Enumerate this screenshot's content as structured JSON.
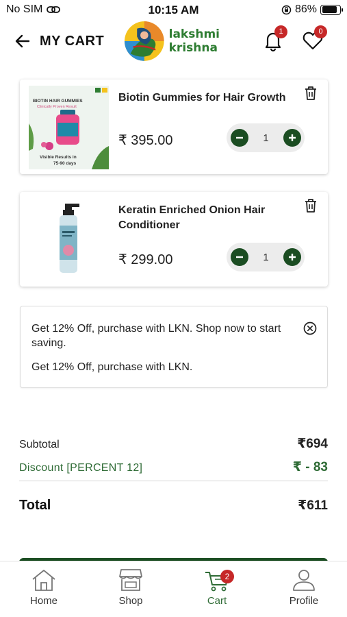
{
  "status_bar": {
    "carrier": "No SIM",
    "time": "10:15 AM",
    "battery_text": "86%",
    "battery_level": 0.86
  },
  "header": {
    "title": "MY CART",
    "logo_line1": "lakshmi",
    "logo_line2": "krishna",
    "notification_count": "1",
    "wishlist_count": "0"
  },
  "cart": {
    "items": [
      {
        "name": "Biotin Gummies for Hair Growth",
        "price": "₹ 395.00",
        "quantity": "1",
        "image_text": {
          "line1": "BIOTIN HAIR GUMMIES",
          "line2": "Clinically Proven Result",
          "line3": "Visible Results in",
          "line4": "75-90 days"
        }
      },
      {
        "name": "Keratin Enriched Onion Hair Conditioner",
        "price": "₹ 299.00",
        "quantity": "1"
      }
    ]
  },
  "offer": {
    "line1": "Get 12% Off, purchase with LKN. Shop now to start saving.",
    "line2": "Get 12% Off, purchase with LKN."
  },
  "summary": {
    "subtotal_label": "Subtotal",
    "subtotal_value": "₹694",
    "discount_label": "Discount [PERCENT 12]",
    "discount_value": "₹ - 83",
    "total_label": "Total",
    "total_value": "₹611"
  },
  "bottom_nav": {
    "items": [
      {
        "label": "Home",
        "icon": "home-icon"
      },
      {
        "label": "Shop",
        "icon": "shop-icon"
      },
      {
        "label": "Cart",
        "icon": "cart-icon",
        "badge": "2"
      },
      {
        "label": "Profile",
        "icon": "profile-icon"
      }
    ]
  },
  "colors": {
    "primary_green": "#1b4d22",
    "discount_green": "#2e6b35",
    "badge_red": "#c62828"
  }
}
